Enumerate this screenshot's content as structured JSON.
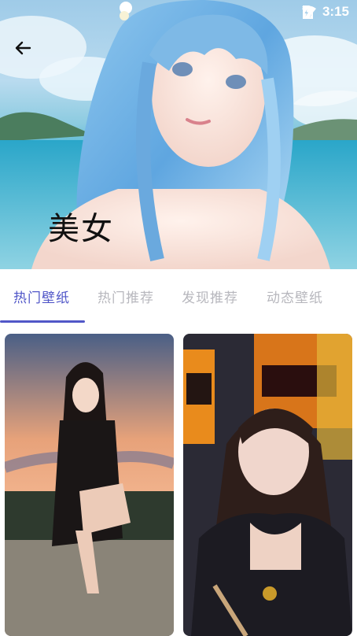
{
  "status_bar": {
    "time": "3:15",
    "icons": [
      "wifi-icon",
      "no-sim-icon",
      "battery-charging-icon"
    ]
  },
  "header": {
    "back_icon": "arrow-left-icon",
    "title": "美女"
  },
  "tabs": [
    {
      "label": "热门壁纸",
      "active": true
    },
    {
      "label": "热门推荐",
      "active": false
    },
    {
      "label": "发现推荐",
      "active": false
    },
    {
      "label": "动态壁纸",
      "active": false
    }
  ],
  "colors": {
    "accent": "#5157c8",
    "tab_inactive": "#b7b7bd",
    "title": "#111111"
  },
  "wallpapers": [
    {
      "image": "woman-sunset-portrait"
    },
    {
      "image": "woman-arcade-portrait"
    }
  ]
}
